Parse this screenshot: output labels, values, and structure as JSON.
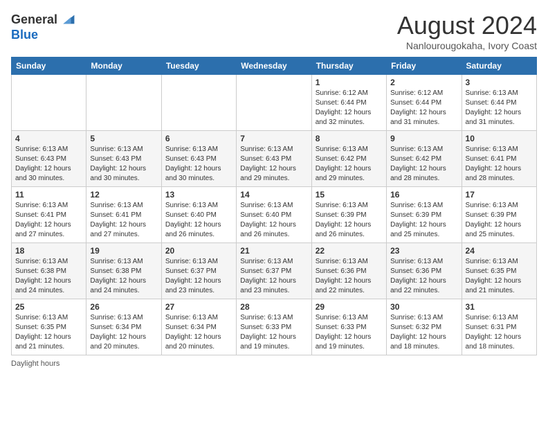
{
  "logo": {
    "general": "General",
    "blue": "Blue"
  },
  "title": "August 2024",
  "location": "Nanlourougokaha, Ivory Coast",
  "days_of_week": [
    "Sunday",
    "Monday",
    "Tuesday",
    "Wednesday",
    "Thursday",
    "Friday",
    "Saturday"
  ],
  "footer": "Daylight hours",
  "weeks": [
    [
      {
        "day": "",
        "info": ""
      },
      {
        "day": "",
        "info": ""
      },
      {
        "day": "",
        "info": ""
      },
      {
        "day": "",
        "info": ""
      },
      {
        "day": "1",
        "info": "Sunrise: 6:12 AM\nSunset: 6:44 PM\nDaylight: 12 hours\nand 32 minutes."
      },
      {
        "day": "2",
        "info": "Sunrise: 6:12 AM\nSunset: 6:44 PM\nDaylight: 12 hours\nand 31 minutes."
      },
      {
        "day": "3",
        "info": "Sunrise: 6:13 AM\nSunset: 6:44 PM\nDaylight: 12 hours\nand 31 minutes."
      }
    ],
    [
      {
        "day": "4",
        "info": "Sunrise: 6:13 AM\nSunset: 6:43 PM\nDaylight: 12 hours\nand 30 minutes."
      },
      {
        "day": "5",
        "info": "Sunrise: 6:13 AM\nSunset: 6:43 PM\nDaylight: 12 hours\nand 30 minutes."
      },
      {
        "day": "6",
        "info": "Sunrise: 6:13 AM\nSunset: 6:43 PM\nDaylight: 12 hours\nand 30 minutes."
      },
      {
        "day": "7",
        "info": "Sunrise: 6:13 AM\nSunset: 6:43 PM\nDaylight: 12 hours\nand 29 minutes."
      },
      {
        "day": "8",
        "info": "Sunrise: 6:13 AM\nSunset: 6:42 PM\nDaylight: 12 hours\nand 29 minutes."
      },
      {
        "day": "9",
        "info": "Sunrise: 6:13 AM\nSunset: 6:42 PM\nDaylight: 12 hours\nand 28 minutes."
      },
      {
        "day": "10",
        "info": "Sunrise: 6:13 AM\nSunset: 6:41 PM\nDaylight: 12 hours\nand 28 minutes."
      }
    ],
    [
      {
        "day": "11",
        "info": "Sunrise: 6:13 AM\nSunset: 6:41 PM\nDaylight: 12 hours\nand 27 minutes."
      },
      {
        "day": "12",
        "info": "Sunrise: 6:13 AM\nSunset: 6:41 PM\nDaylight: 12 hours\nand 27 minutes."
      },
      {
        "day": "13",
        "info": "Sunrise: 6:13 AM\nSunset: 6:40 PM\nDaylight: 12 hours\nand 26 minutes."
      },
      {
        "day": "14",
        "info": "Sunrise: 6:13 AM\nSunset: 6:40 PM\nDaylight: 12 hours\nand 26 minutes."
      },
      {
        "day": "15",
        "info": "Sunrise: 6:13 AM\nSunset: 6:39 PM\nDaylight: 12 hours\nand 26 minutes."
      },
      {
        "day": "16",
        "info": "Sunrise: 6:13 AM\nSunset: 6:39 PM\nDaylight: 12 hours\nand 25 minutes."
      },
      {
        "day": "17",
        "info": "Sunrise: 6:13 AM\nSunset: 6:39 PM\nDaylight: 12 hours\nand 25 minutes."
      }
    ],
    [
      {
        "day": "18",
        "info": "Sunrise: 6:13 AM\nSunset: 6:38 PM\nDaylight: 12 hours\nand 24 minutes."
      },
      {
        "day": "19",
        "info": "Sunrise: 6:13 AM\nSunset: 6:38 PM\nDaylight: 12 hours\nand 24 minutes."
      },
      {
        "day": "20",
        "info": "Sunrise: 6:13 AM\nSunset: 6:37 PM\nDaylight: 12 hours\nand 23 minutes."
      },
      {
        "day": "21",
        "info": "Sunrise: 6:13 AM\nSunset: 6:37 PM\nDaylight: 12 hours\nand 23 minutes."
      },
      {
        "day": "22",
        "info": "Sunrise: 6:13 AM\nSunset: 6:36 PM\nDaylight: 12 hours\nand 22 minutes."
      },
      {
        "day": "23",
        "info": "Sunrise: 6:13 AM\nSunset: 6:36 PM\nDaylight: 12 hours\nand 22 minutes."
      },
      {
        "day": "24",
        "info": "Sunrise: 6:13 AM\nSunset: 6:35 PM\nDaylight: 12 hours\nand 21 minutes."
      }
    ],
    [
      {
        "day": "25",
        "info": "Sunrise: 6:13 AM\nSunset: 6:35 PM\nDaylight: 12 hours\nand 21 minutes."
      },
      {
        "day": "26",
        "info": "Sunrise: 6:13 AM\nSunset: 6:34 PM\nDaylight: 12 hours\nand 20 minutes."
      },
      {
        "day": "27",
        "info": "Sunrise: 6:13 AM\nSunset: 6:34 PM\nDaylight: 12 hours\nand 20 minutes."
      },
      {
        "day": "28",
        "info": "Sunrise: 6:13 AM\nSunset: 6:33 PM\nDaylight: 12 hours\nand 19 minutes."
      },
      {
        "day": "29",
        "info": "Sunrise: 6:13 AM\nSunset: 6:33 PM\nDaylight: 12 hours\nand 19 minutes."
      },
      {
        "day": "30",
        "info": "Sunrise: 6:13 AM\nSunset: 6:32 PM\nDaylight: 12 hours\nand 18 minutes."
      },
      {
        "day": "31",
        "info": "Sunrise: 6:13 AM\nSunset: 6:31 PM\nDaylight: 12 hours\nand 18 minutes."
      }
    ]
  ]
}
